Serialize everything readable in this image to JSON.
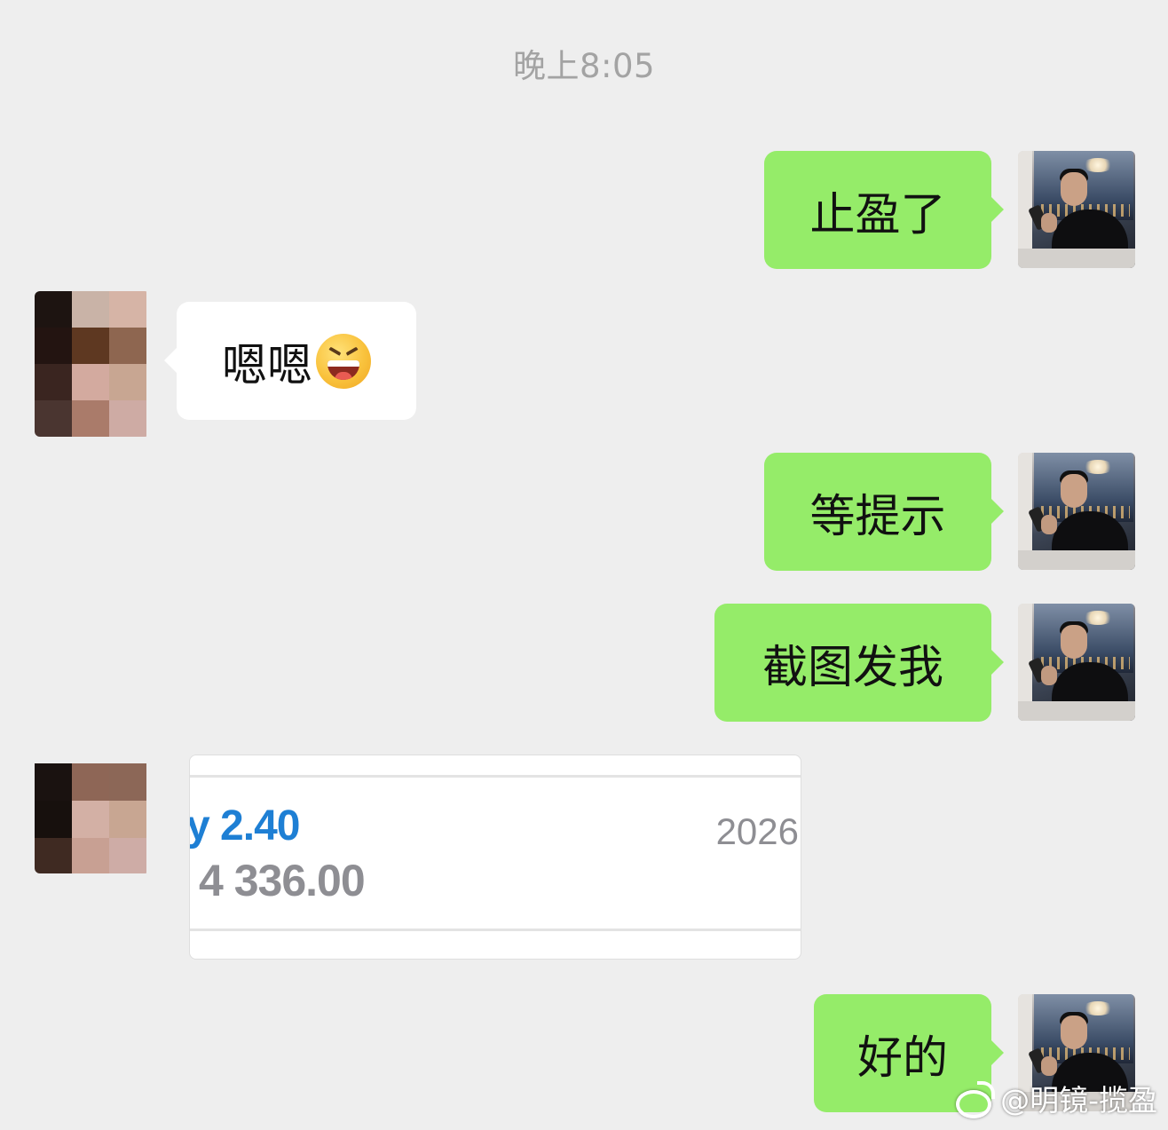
{
  "chat": {
    "timestamp": "晚上8:05",
    "messages": [
      {
        "sender": "me",
        "text": "止盈了"
      },
      {
        "sender": "them",
        "text": "嗯嗯",
        "emoji": "laughing-squinting-emoji"
      },
      {
        "sender": "me",
        "text": "等提示"
      },
      {
        "sender": "me",
        "text": "截图发我"
      },
      {
        "sender": "them",
        "type": "image",
        "image": {
          "lot_text": "y 2.40",
          "price_text": "4 336.00",
          "year_text": "2026"
        }
      },
      {
        "sender": "me",
        "text": "好的"
      }
    ]
  },
  "colors": {
    "background": "#eeeeee",
    "my_bubble": "#95ec69",
    "their_bubble": "#ffffff",
    "timestamp_text": "#a3a3a3",
    "trade_blue": "#1e7fd4",
    "trade_gray": "#8e8e93"
  },
  "watermark": {
    "icon": "weibo-icon",
    "text": "@明镜-揽盈"
  }
}
